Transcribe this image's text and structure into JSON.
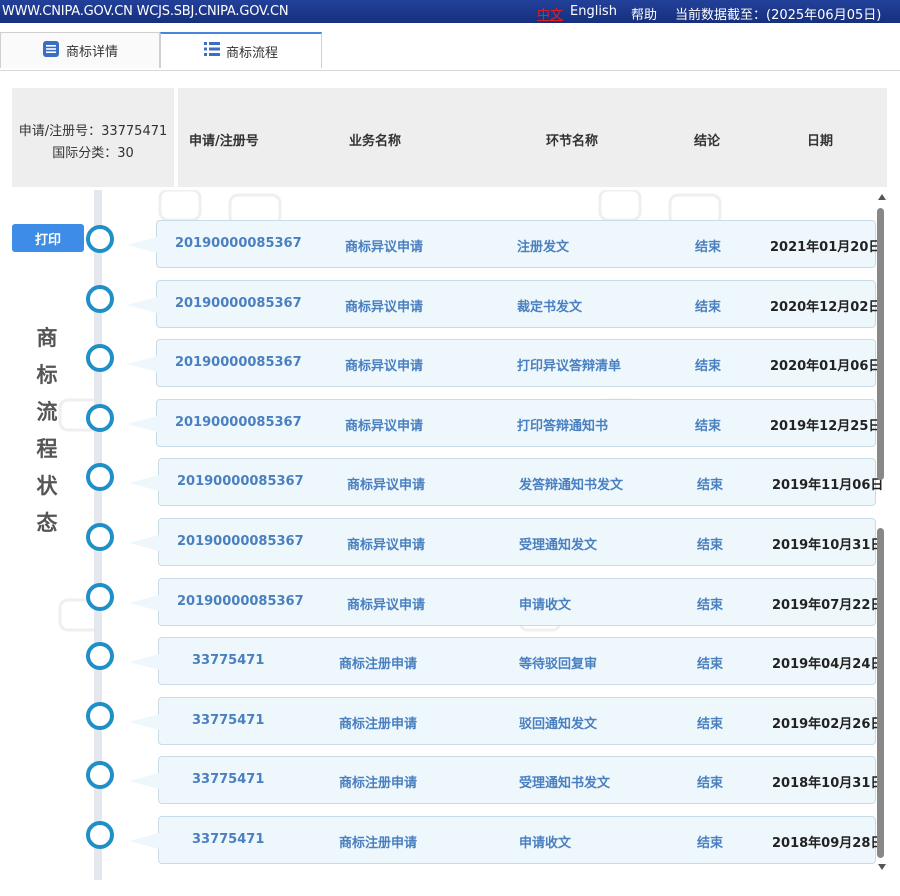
{
  "topbar": {
    "site": "WWW.CNIPA.GOV.CN WCJS.SBJ.CNIPA.GOV.CN",
    "lang_cn": "中文",
    "lang_en": "English",
    "help": "帮助",
    "as_of": "当前数据截至：(2025年06月05日)"
  },
  "tabs": [
    {
      "label": "商标详情",
      "icon": "document-icon"
    },
    {
      "label": "商标流程",
      "icon": "list-icon"
    }
  ],
  "summary": {
    "app_no": "申请/注册号：33775471",
    "intl_class": "国际分类：30"
  },
  "columns": [
    "申请/注册号",
    "业务名称",
    "环节名称",
    "结论",
    "日期"
  ],
  "print_label": "打印",
  "side_title": [
    "商",
    "标",
    "流",
    "程",
    "状",
    "态"
  ],
  "rows": [
    {
      "number": "20190000085367",
      "business": "商标异议申请",
      "step": "注册发文",
      "result": "结束",
      "date": "2021年01月20日"
    },
    {
      "number": "20190000085367",
      "business": "商标异议申请",
      "step": "裁定书发文",
      "result": "结束",
      "date": "2020年12月02日"
    },
    {
      "number": "20190000085367",
      "business": "商标异议申请",
      "step": "打印异议答辩清单",
      "result": "结束",
      "date": "2020年01月06日"
    },
    {
      "number": "20190000085367",
      "business": "商标异议申请",
      "step": "打印答辩通知书",
      "result": "结束",
      "date": "2019年12月25日"
    },
    {
      "number": "20190000085367",
      "business": "商标异议申请",
      "step": "发答辩通知书发文",
      "result": "结束",
      "date": "2019年11月06日"
    },
    {
      "number": "20190000085367",
      "business": "商标异议申请",
      "step": "受理通知发文",
      "result": "结束",
      "date": "2019年10月31日"
    },
    {
      "number": "20190000085367",
      "business": "商标异议申请",
      "step": "申请收文",
      "result": "结束",
      "date": "2019年07月22日"
    },
    {
      "number": "33775471",
      "business": "商标注册申请",
      "step": "等待驳回复审",
      "result": "结束",
      "date": "2019年04月24日"
    },
    {
      "number": "33775471",
      "business": "商标注册申请",
      "step": "驳回通知发文",
      "result": "结束",
      "date": "2019年02月26日"
    },
    {
      "number": "33775471",
      "business": "商标注册申请",
      "step": "受理通知书发文",
      "result": "结束",
      "date": "2018年10月31日"
    },
    {
      "number": "33775471",
      "business": "商标注册申请",
      "step": "申请收文",
      "result": "结束",
      "date": "2018年09月28日"
    }
  ],
  "colors": {
    "topbar": "#1e3a8a",
    "accent": "#3d8ce6",
    "node": "#1f8fc7",
    "card_bg": "#eef8fc",
    "link": "#4a7fc0"
  }
}
